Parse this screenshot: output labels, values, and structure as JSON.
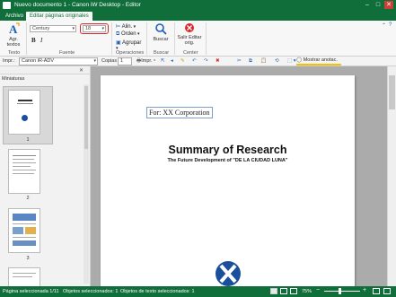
{
  "window": {
    "title": "Nuevo documento 1 - Canon iW Desktop - Editor",
    "minimize": "–",
    "maximize": "□",
    "close": "✕"
  },
  "menu": {
    "tabs": [
      "Archivo",
      "Editar páginas originales"
    ]
  },
  "ribbon": {
    "texto": {
      "button_label": "Agr. textos",
      "group": "Texto"
    },
    "fuente": {
      "font_value": "Century",
      "size_value": "18",
      "bold": "B",
      "italic": "I",
      "group": "Fuente"
    },
    "operaciones": {
      "items": [
        "Alin.",
        "Orden",
        "Agrupar"
      ],
      "group": "Operaciones"
    },
    "buscar": {
      "button_label": "Buscar",
      "group": "Buscar"
    },
    "center": {
      "button_label": "Salir Editar orig.",
      "group": "Center"
    }
  },
  "toolbar2": {
    "printer_label": "Impr.:",
    "printer_value": "Canon iR-ADV",
    "copies_label": "Copias",
    "copies_value": "1",
    "print_label": "Impr.",
    "show_annotations": "Mostrar anotac."
  },
  "sidebar": {
    "title": "Miniaturas",
    "pages": [
      "1",
      "2",
      "3"
    ]
  },
  "document": {
    "for_text": "For: XX Corporation",
    "heading": "Summary of Research",
    "subheading": "The Future Development of \"DE LA CIUDAD LUNA\""
  },
  "status": {
    "selected_page": "Página seleccionada 1/11",
    "objects_selected": "Objetos seleccionados: 1",
    "text_objects_selected": "Objetos de texto seleccionados: 1",
    "zoom": "75%"
  },
  "colors": {
    "accent": "#0f6e3a",
    "highlight": "#d9262b",
    "annotation": "#f2c300"
  }
}
